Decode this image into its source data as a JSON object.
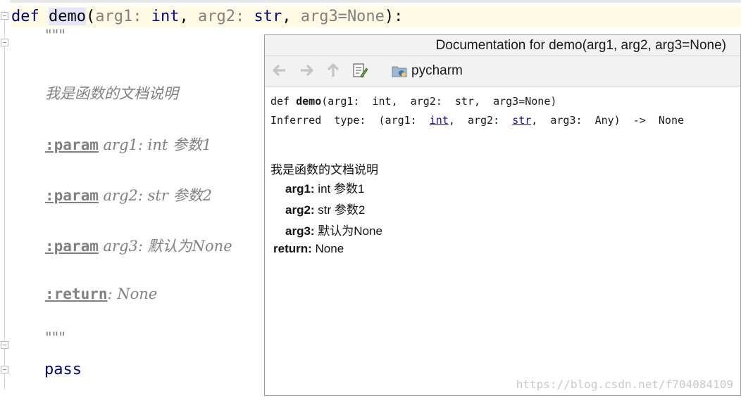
{
  "editor": {
    "def_keyword": "def",
    "func_name": "demo",
    "open_paren": "(",
    "arg1": "arg1",
    "arg1_sep": ": ",
    "arg1_type": "int",
    "comma1": ", ",
    "arg2": "arg2",
    "arg2_sep": ": ",
    "arg2_type": "str",
    "comma2": ", ",
    "arg3": "arg3=",
    "arg3_default": "None",
    "close": "):",
    "docstring_open": "\"\"\"",
    "doc_description": "我是函数的文档说明",
    "param_tag": ":param",
    "param1_text": " arg1: int 参数1",
    "param2_text": " arg2: str 参数2",
    "param3_text": " arg3: 默认为None",
    "return_tag": ":return",
    "return_text": ": None",
    "docstring_close": "\"\"\"",
    "pass_keyword": "pass"
  },
  "popup": {
    "title": "Documentation for demo(arg1, arg2, arg3=None)",
    "module_name": "pycharm",
    "icons": [
      "back-arrow-icon",
      "forward-arrow-icon",
      "up-arrow-icon",
      "edit-source-icon",
      "python-package-icon"
    ],
    "signature": {
      "def": "def ",
      "name": "demo",
      "params": "(arg1:  int,  arg2:  str,  arg3=None)"
    },
    "inferred": {
      "prefix": "Inferred  type:  (arg1:  ",
      "int_link": "int",
      "mid": ",  arg2:  ",
      "str_link": "str",
      "suffix": ",  arg3:  Any)  ->  None"
    },
    "description": "我是函数的文档说明",
    "params": [
      {
        "name": "arg1:",
        "desc": " int 参数1"
      },
      {
        "name": "arg2:",
        "desc": " str 参数2"
      },
      {
        "name": "arg3:",
        "desc": " 默认为None"
      }
    ],
    "return": {
      "name": "return:",
      "desc": " None"
    },
    "watermark": "https://blog.csdn.net/f704084109"
  }
}
